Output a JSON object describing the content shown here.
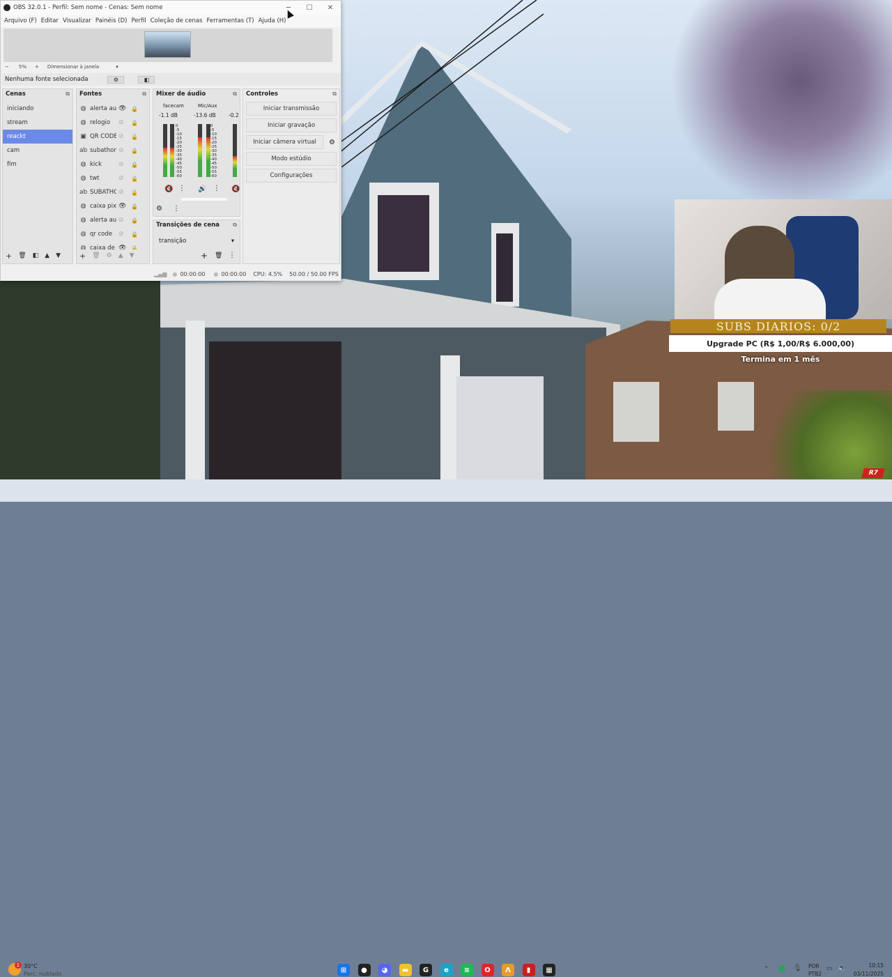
{
  "window": {
    "title": "OBS 32.0.1 - Perfil: Sem nome - Cenas: Sem nome",
    "minimize": "─",
    "maximize": "☐",
    "close": "✕"
  },
  "menu": [
    "Arquivo (F)",
    "Editar",
    "Visualizar",
    "Painéis (D)",
    "Perfil",
    "Coleção de cenas",
    "Ferramentas (T)",
    "Ajuda (H)"
  ],
  "zoom": {
    "minus": "−",
    "value": "5%",
    "plus": "+",
    "mode": "Dimensionar à janela"
  },
  "no_source": "Nenhuma fonte selecionada",
  "scenes": {
    "title": "Cenas",
    "items": [
      "iniciando",
      "stream",
      "reackt",
      "cam",
      "fim"
    ],
    "selected": "reackt"
  },
  "sources": {
    "title": "Fontes",
    "items": [
      {
        "icon": "globe-icon",
        "label": "alerta aui",
        "visible": true
      },
      {
        "icon": "globe-icon",
        "label": "relogio",
        "visible": false
      },
      {
        "icon": "qr-icon",
        "label": "QR CODE",
        "visible": false
      },
      {
        "icon": "text-icon",
        "label": "subathon",
        "visible": false
      },
      {
        "icon": "globe-icon",
        "label": "kick",
        "visible": false
      },
      {
        "icon": "globe-icon",
        "label": "twt",
        "visible": false
      },
      {
        "icon": "text-icon",
        "label": "SUBATHO",
        "visible": false
      },
      {
        "icon": "globe-icon",
        "label": "caixa pix",
        "visible": true
      },
      {
        "icon": "globe-icon",
        "label": "alerta aui",
        "visible": false
      },
      {
        "icon": "globe-icon",
        "label": "qr code",
        "visible": false
      },
      {
        "icon": "globe-icon",
        "label": "caixa de",
        "visible": true
      }
    ]
  },
  "mixer": {
    "title": "Mixer de áudio",
    "channels": [
      {
        "name": "facecam",
        "db": "-1.1 dB",
        "level": 0.55,
        "muted": true
      },
      {
        "name": "Mic/Aux",
        "db": "-13.6 dB",
        "level": 0.75,
        "muted": false
      },
      {
        "name": "",
        "db": "-0.2",
        "level": 0.4,
        "muted": true
      }
    ],
    "scale": [
      "0",
      "-5",
      "-10",
      "-15",
      "-20",
      "-25",
      "-30",
      "-35",
      "-40",
      "-45",
      "-50",
      "-55",
      "-60"
    ]
  },
  "transitions": {
    "title": "Transições de cena",
    "value": "transição"
  },
  "controls": {
    "title": "Controles",
    "buttons": [
      "Iniciar transmissão",
      "Iniciar gravação",
      "Iniciar câmera virtual",
      "Modo estúdio",
      "Configurações"
    ]
  },
  "status": {
    "rec_time": "00:00:00",
    "stream_time": "00:00:00",
    "cpu": "CPU: 4.5%",
    "fps": "50.00 / 50.00 FPS"
  },
  "overlay": {
    "subs": "SUBS DIARIOS: 0/2",
    "goal": "Upgrade PC (R$ 1,00/R$ 6.000,00)",
    "ends": "Termina em 1 mês"
  },
  "taskbar": {
    "weather_temp": "30°C",
    "weather_desc": "Parc. nublado",
    "weather_badge": "1",
    "lang": "POR",
    "layout": "PTB2",
    "time": "10:15",
    "date": "03/11/2025",
    "apps": [
      {
        "name": "windows-start-icon",
        "glyph": "⊞",
        "color": "#1a73e8"
      },
      {
        "name": "obs-icon",
        "glyph": "●",
        "color": "#222222"
      },
      {
        "name": "discord-icon",
        "glyph": "◕",
        "color": "#5865f2"
      },
      {
        "name": "file-explorer-icon",
        "glyph": "▬",
        "color": "#f2c12e"
      },
      {
        "name": "g-app-icon",
        "glyph": "G",
        "color": "#222222"
      },
      {
        "name": "edge-icon",
        "glyph": "e",
        "color": "#1aa3c9"
      },
      {
        "name": "spotify-icon",
        "glyph": "≋",
        "color": "#1db954"
      },
      {
        "name": "opera-icon",
        "glyph": "O",
        "color": "#e0242c"
      },
      {
        "name": "app-a-icon",
        "glyph": "Λ",
        "color": "#e89a2c"
      },
      {
        "name": "app-red-icon",
        "glyph": "▮",
        "color": "#c8201f"
      },
      {
        "name": "app-dark-icon",
        "glyph": "▦",
        "color": "#222222"
      }
    ]
  }
}
